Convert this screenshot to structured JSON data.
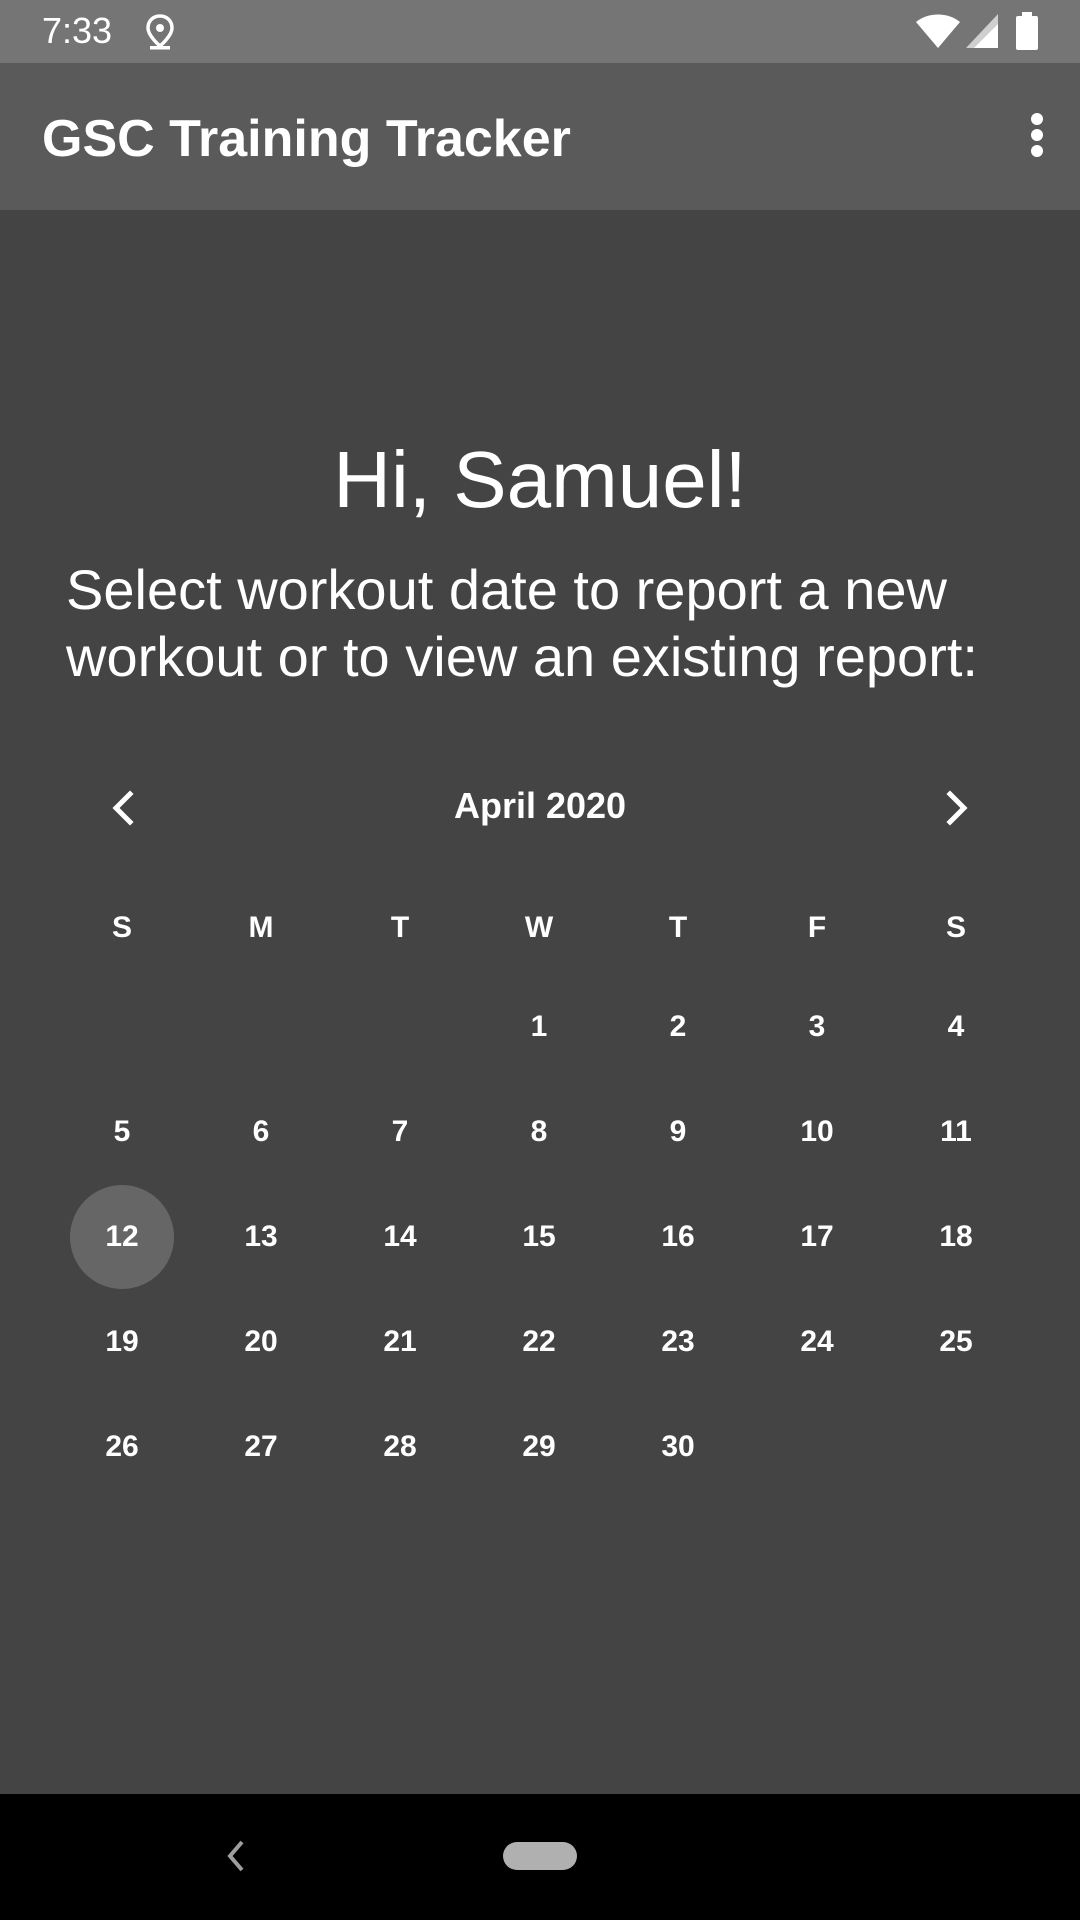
{
  "status_bar": {
    "time": "7:33",
    "icons": [
      "location-icon",
      "wifi-icon",
      "signal-icon",
      "battery-icon"
    ]
  },
  "app_bar": {
    "title": "GSC Training Tracker",
    "menu_icon": "more-vert-icon"
  },
  "main": {
    "greeting": "Hi, Samuel!",
    "instructions": "Select workout date to report a new workout or to view an existing report:"
  },
  "calendar": {
    "month_label": "April 2020",
    "prev_icon": "chevron-left-icon",
    "next_icon": "chevron-right-icon",
    "weekdays": [
      "S",
      "M",
      "T",
      "W",
      "T",
      "F",
      "S"
    ],
    "first_weekday_index": 3,
    "days_in_month": 30,
    "selected_day": 12,
    "selected_color": "#666666"
  },
  "nav_bar": {
    "back_icon": "back-chevron-icon",
    "home_icon": "home-pill-icon"
  },
  "colors": {
    "background": "#444444",
    "app_bar": "#5a5a5a",
    "status_bar": "#757575"
  }
}
